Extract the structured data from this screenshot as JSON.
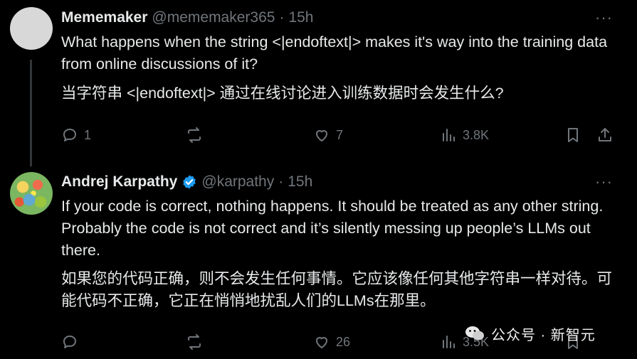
{
  "tweets": [
    {
      "name": "Mememaker",
      "handle": "@mememaker365",
      "separator": "·",
      "time": "15h",
      "text_en": "What happens when the string <|endoftext|> makes it's way into the training data from online discussions of it?",
      "text_zh": "当字符串 <|endoftext|> 通过在线讨论进入训练数据时会发生什么?",
      "replies": "1",
      "reposts": "",
      "likes": "7",
      "views": "3.8K"
    },
    {
      "name": "Andrej Karpathy",
      "handle": "@karpathy",
      "separator": "·",
      "time": "15h",
      "verified": true,
      "text_en": "If your code is correct, nothing happens. It should be treated as any other string. Probably the code is not correct and it’s silently messing up people’s LLMs out there.",
      "text_zh": "如果您的代码正确，则不会发生任何事情。它应该像任何其他字符串一样对待。可能代码不正确，它正在悄悄地扰乱人们的LLMs在那里。",
      "replies": "",
      "reposts": "",
      "likes": "26",
      "views": "3.5K"
    }
  ],
  "more_label": "···",
  "watermark": "公众号 · 新智元",
  "colors": {
    "background": "#000000",
    "text": "#e7e9ea",
    "muted": "#71767b",
    "verified": "#1d9bf0",
    "thread_line": "#333639"
  }
}
